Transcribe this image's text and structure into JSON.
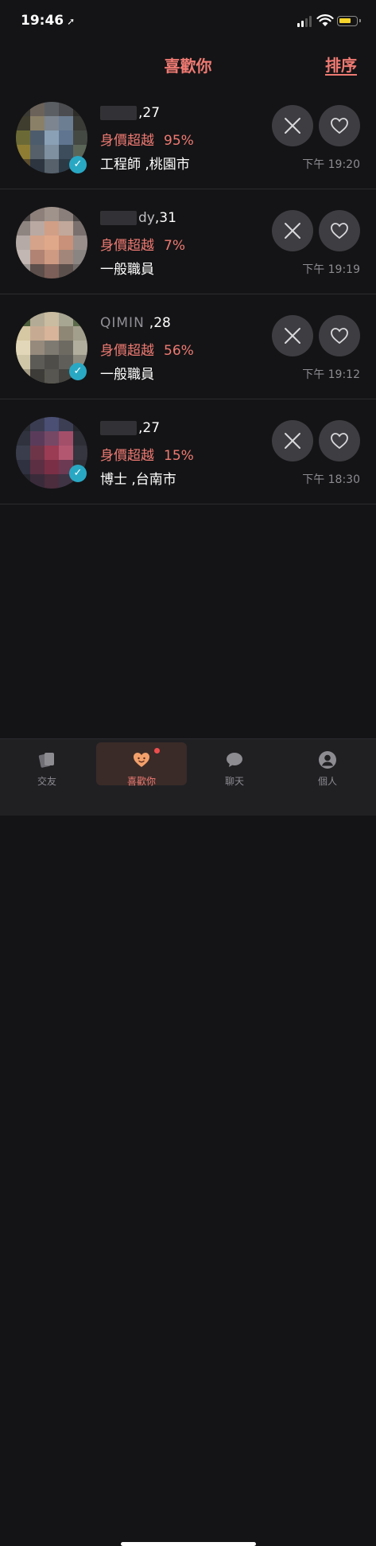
{
  "status_bar": {
    "time": "19:46",
    "location_arrow": "➚"
  },
  "header": {
    "title": "喜歡你",
    "sort_label": "排序"
  },
  "likes": [
    {
      "name": "",
      "age": ",27",
      "income_label": "身價超越",
      "percentile": "95%",
      "job_location": "工程師  ,桃園市",
      "time": "下午 19:20",
      "verified": true
    },
    {
      "name": "dy",
      "age": ",31",
      "income_label": "身價超越",
      "percentile": "7%",
      "job_location": "一般職員",
      "time": "下午 19:19",
      "verified": false
    },
    {
      "name": "QIMIN",
      "age": ",28",
      "income_label": "身價超越",
      "percentile": "56%",
      "job_location": "一般職員",
      "time": "下午 19:12",
      "verified": true
    },
    {
      "name": "",
      "age": ",27",
      "income_label": "身價超越",
      "percentile": "15%",
      "job_location": "博士  ,台南市",
      "time": "下午 18:30",
      "verified": true
    }
  ],
  "tabbar": {
    "tabs": [
      {
        "label": "交友",
        "icon": "cards-icon"
      },
      {
        "label": "喜歡你",
        "icon": "heart-face-icon"
      },
      {
        "label": "聊天",
        "icon": "chat-bubble-icon"
      },
      {
        "label": "個人",
        "icon": "person-icon"
      }
    ],
    "active": "喜歡你"
  },
  "colors": {
    "accent": "#ef7a72",
    "background": "#141416",
    "verified": "#29a8c4"
  }
}
